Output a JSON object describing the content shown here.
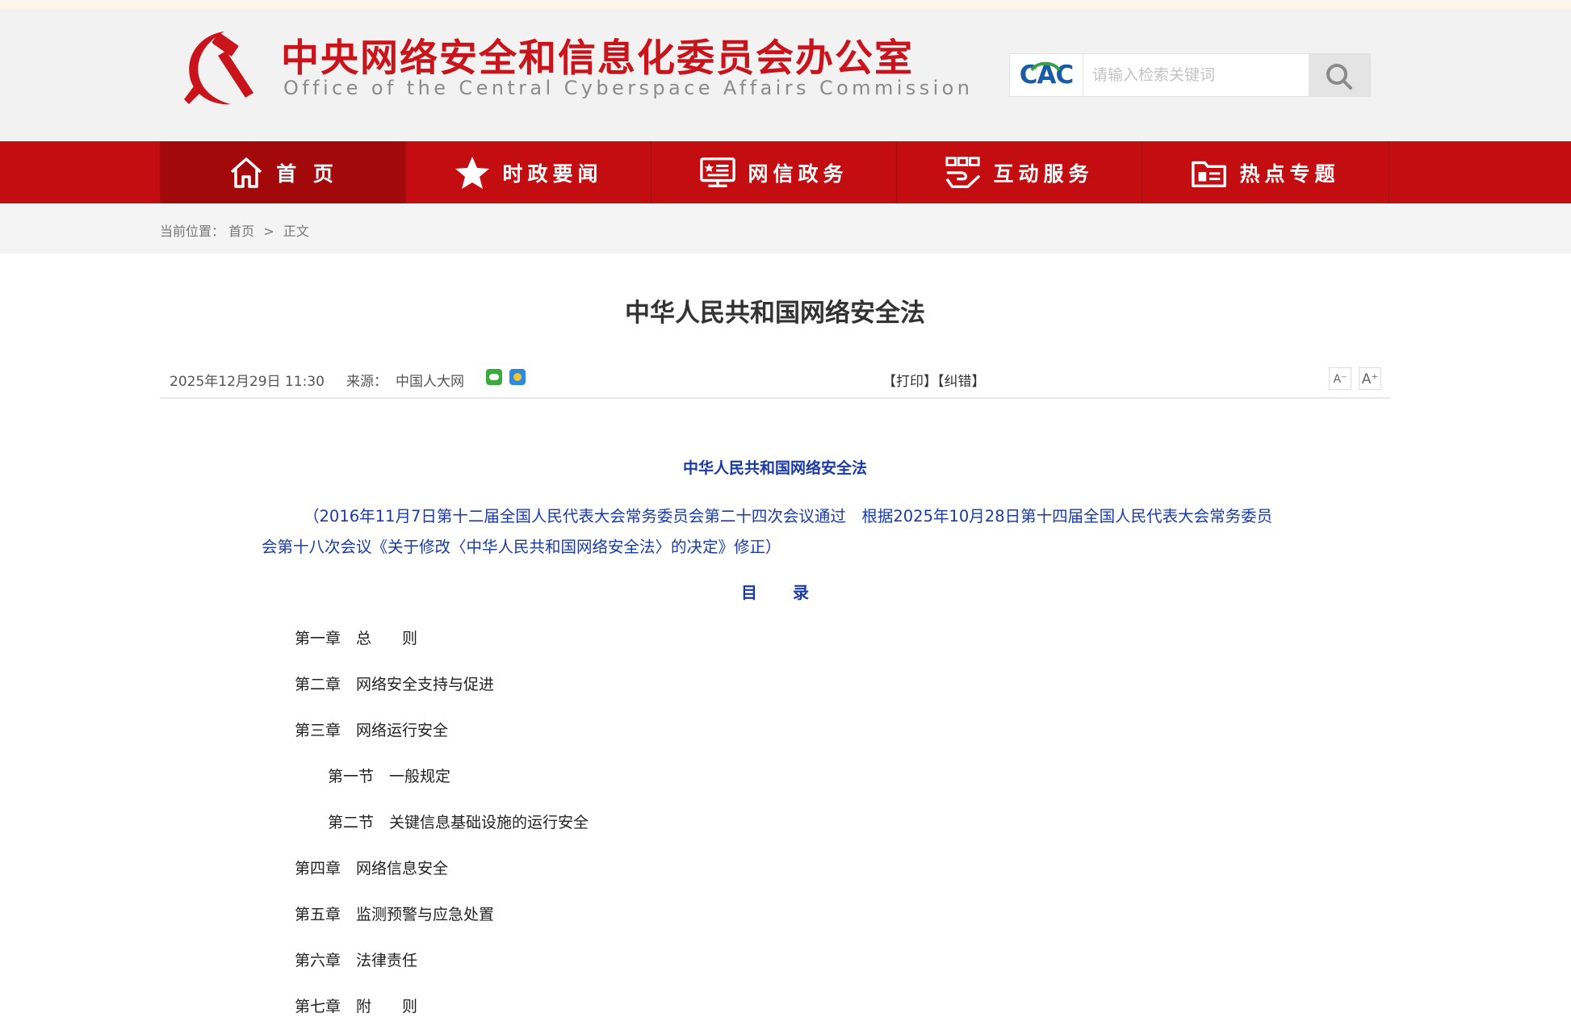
{
  "header": {
    "site_title_cn": "中央网络安全和信息化委员会办公室",
    "site_title_en": "Office of the Central Cyberspace Affairs Commission",
    "search_logo": "CAC",
    "search_placeholder": "请输入检索关键词",
    "search_button_icon": "search-icon"
  },
  "nav": {
    "items": [
      {
        "label": "首 页",
        "icon": "home-icon"
      },
      {
        "label": "时政要闻",
        "icon": "star-icon"
      },
      {
        "label": "网信政务",
        "icon": "monitor-icon"
      },
      {
        "label": "互动服务",
        "icon": "interaction-icon"
      },
      {
        "label": "热点专题",
        "icon": "folder-icon"
      }
    ]
  },
  "breadcrumb": {
    "label": "当前位置：",
    "home": "首页",
    "separator": ">",
    "current": "正文"
  },
  "article": {
    "title": "中华人民共和国网络安全法",
    "date": "2025年12月29日 11:30",
    "source_label": "来源：",
    "source": "中国人大网",
    "print_links": "【打印】【纠错】",
    "font_small": "A⁻",
    "font_big": "A⁺",
    "doc_title": "中华人民共和国网络安全法",
    "preamble_line1": "（2016年11月7日第十二届全国人民代表大会常务委员会第二十四次会议通过　根据2025年10月28日第十四届全国人民代表大会常务委员",
    "preamble_line2": "会第十八次会议《关于修改〈中华人民共和国网络安全法〉的决定》修正）",
    "toc_heading": "目录",
    "toc": [
      "第一章　总　　则",
      "第二章　网络安全支持与促进",
      "第三章　网络运行安全",
      "第一节　一般规定",
      "第二节　关键信息基础设施的运行安全",
      "第四章　网络信息安全",
      "第五章　监测预警与应急处置",
      "第六章　法律责任",
      "第七章　附　　则"
    ]
  },
  "colors": {
    "brand_red": "#c40d10",
    "active_nav": "#a3080b",
    "link_blue": "#1a3aa8",
    "title_red": "#c9141c"
  }
}
